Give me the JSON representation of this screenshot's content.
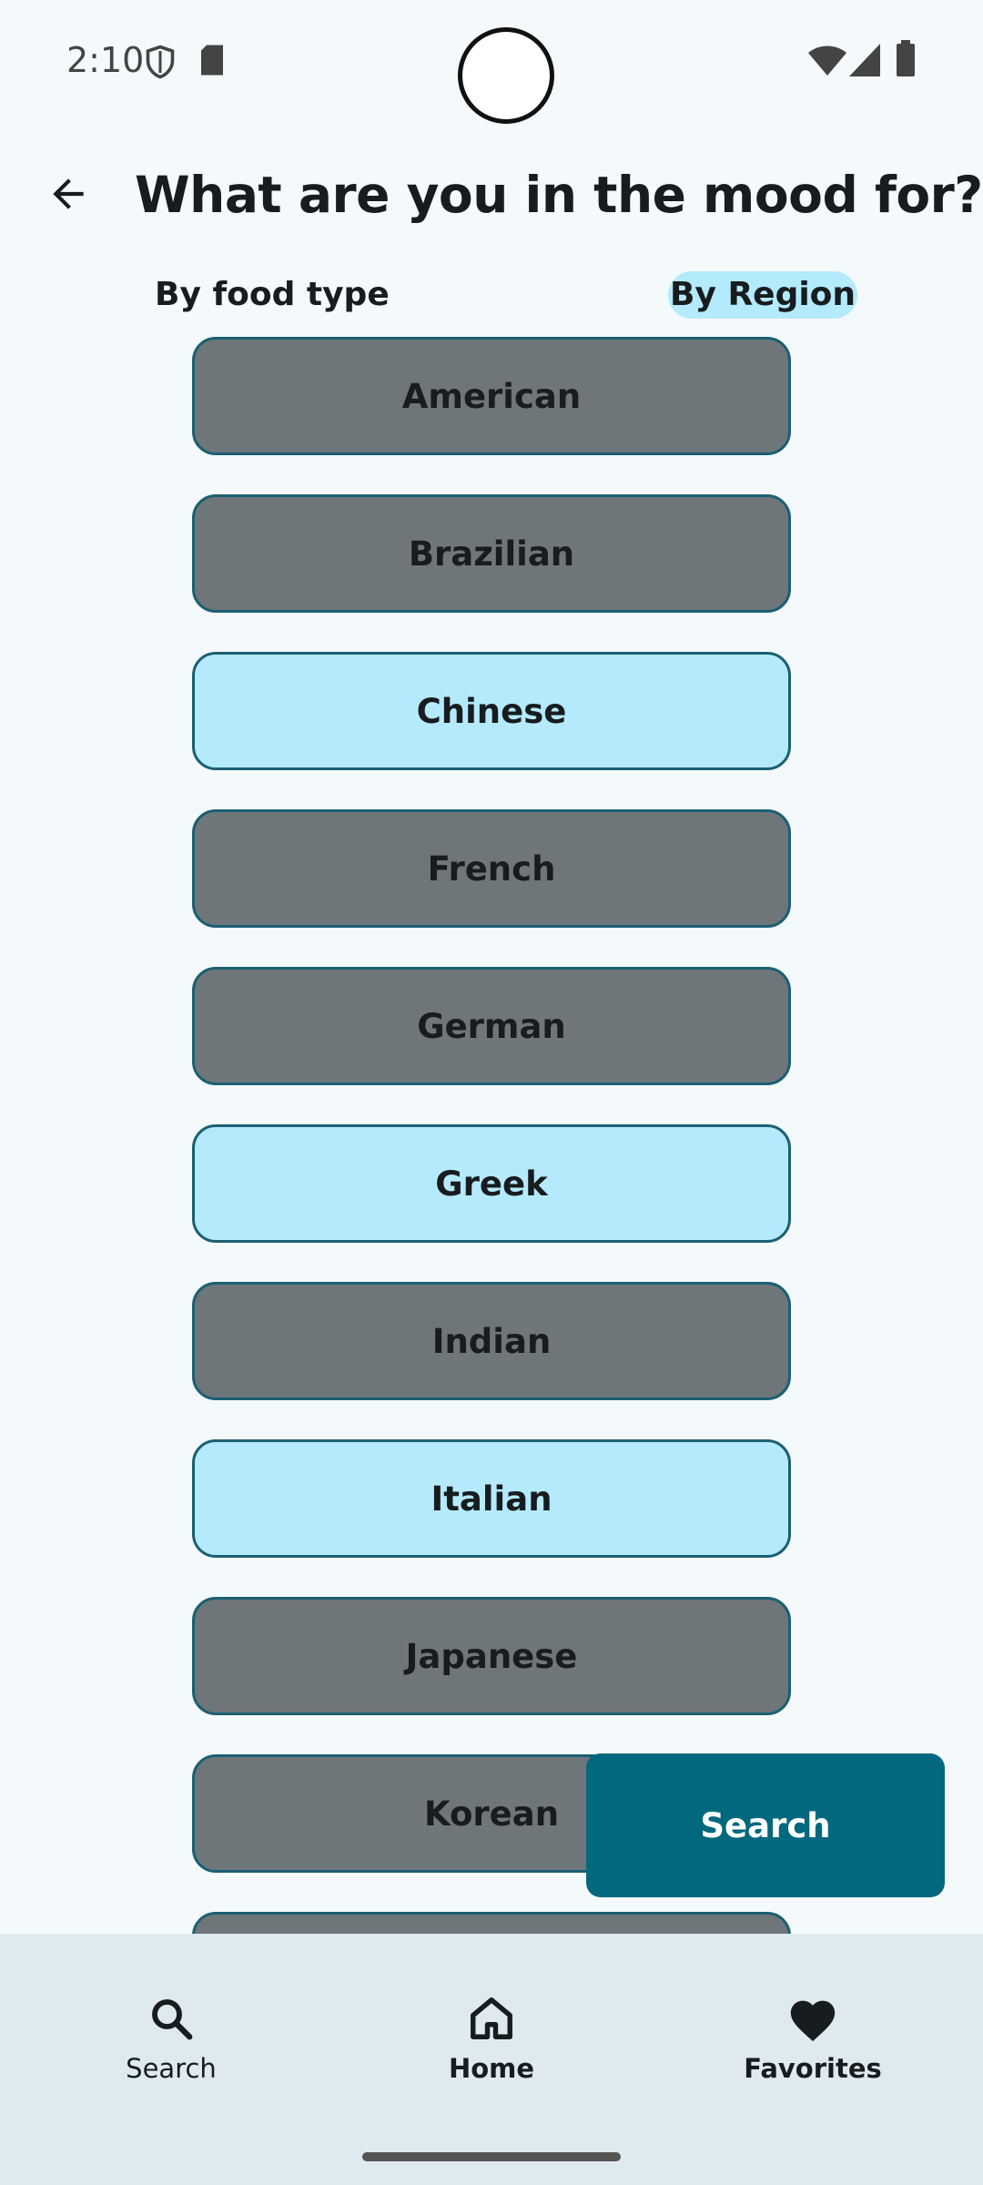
{
  "status": {
    "time": "2:10"
  },
  "header": {
    "title": "What are you in the mood for?"
  },
  "tabs": {
    "food_type": "By food type",
    "region": "By Region"
  },
  "cuisines": [
    {
      "label": "American",
      "selected": false
    },
    {
      "label": "Brazilian",
      "selected": false
    },
    {
      "label": "Chinese",
      "selected": true
    },
    {
      "label": "French",
      "selected": false
    },
    {
      "label": "German",
      "selected": false
    },
    {
      "label": "Greek",
      "selected": true
    },
    {
      "label": "Indian",
      "selected": false
    },
    {
      "label": "Italian",
      "selected": true
    },
    {
      "label": "Japanese",
      "selected": false
    },
    {
      "label": "Korean",
      "selected": false
    },
    {
      "label": "",
      "selected": false
    }
  ],
  "search_button": {
    "label": "Search"
  },
  "nav": {
    "search": "Search",
    "home": "Home",
    "favorites": "Favorites"
  },
  "colors": {
    "selected": "#b4eafc",
    "unselected": "#6e7679",
    "accent": "#02687e",
    "border": "#1b5f73"
  }
}
